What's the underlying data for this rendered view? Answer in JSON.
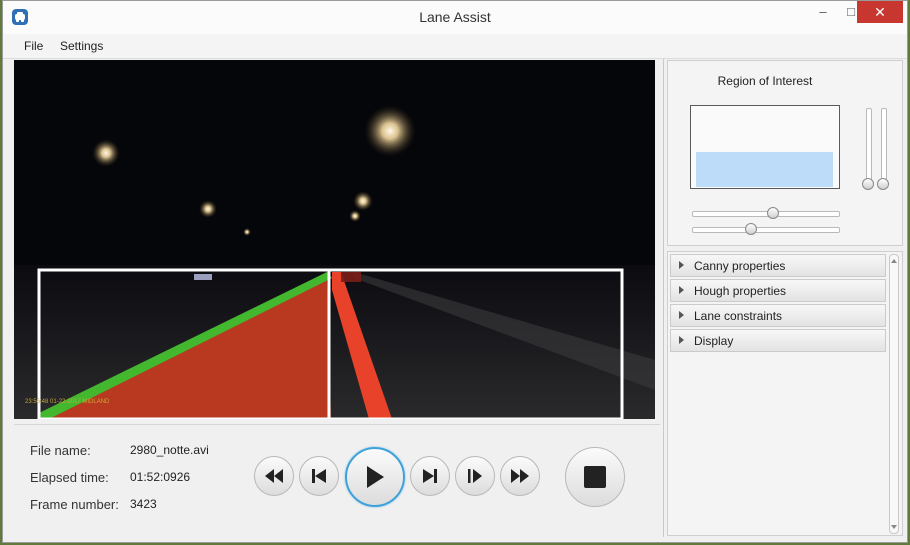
{
  "window": {
    "title": "Lane Assist",
    "app_icon": "car-icon",
    "controls": {
      "minimize": "–",
      "maximize": "□",
      "close": "✕"
    }
  },
  "menubar": {
    "items": [
      "File",
      "Settings"
    ]
  },
  "video": {
    "overlay_text": "23:56:48  01-22-2017    MIDLAND",
    "colors": {
      "left_lane": "#43b82e",
      "fill": "#b8391f",
      "right_lane": "#e8432a",
      "roi_frame": "#ffffff"
    }
  },
  "info": {
    "file_name_label": "File name:",
    "file_name": "2980_notte.avi",
    "elapsed_label": "Elapsed time:",
    "elapsed": "01:52:0926",
    "frame_label": "Frame number:",
    "frame": "3423"
  },
  "playback": {
    "buttons": [
      "fast-rewind-icon",
      "skip-previous-icon",
      "play-icon",
      "skip-next-icon",
      "step-forward-icon",
      "fast-forward-icon",
      "stop-icon"
    ]
  },
  "roi": {
    "label": "Region of Interest",
    "vertical_sliders": [
      0.0,
      0.0
    ],
    "horizontal_sliders": [
      0.55,
      0.4
    ]
  },
  "accordion": {
    "items": [
      "Canny properties",
      "Hough properties",
      "Lane constraints",
      "Display"
    ]
  }
}
